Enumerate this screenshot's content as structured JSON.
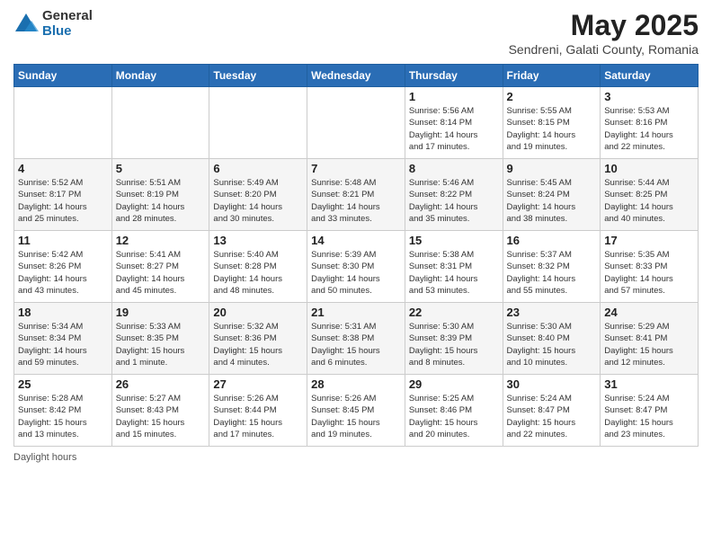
{
  "logo": {
    "general": "General",
    "blue": "Blue"
  },
  "title": "May 2025",
  "subtitle": "Sendreni, Galati County, Romania",
  "days_header": [
    "Sunday",
    "Monday",
    "Tuesday",
    "Wednesday",
    "Thursday",
    "Friday",
    "Saturday"
  ],
  "weeks": [
    [
      {
        "num": "",
        "info": ""
      },
      {
        "num": "",
        "info": ""
      },
      {
        "num": "",
        "info": ""
      },
      {
        "num": "",
        "info": ""
      },
      {
        "num": "1",
        "info": "Sunrise: 5:56 AM\nSunset: 8:14 PM\nDaylight: 14 hours\nand 17 minutes."
      },
      {
        "num": "2",
        "info": "Sunrise: 5:55 AM\nSunset: 8:15 PM\nDaylight: 14 hours\nand 19 minutes."
      },
      {
        "num": "3",
        "info": "Sunrise: 5:53 AM\nSunset: 8:16 PM\nDaylight: 14 hours\nand 22 minutes."
      }
    ],
    [
      {
        "num": "4",
        "info": "Sunrise: 5:52 AM\nSunset: 8:17 PM\nDaylight: 14 hours\nand 25 minutes."
      },
      {
        "num": "5",
        "info": "Sunrise: 5:51 AM\nSunset: 8:19 PM\nDaylight: 14 hours\nand 28 minutes."
      },
      {
        "num": "6",
        "info": "Sunrise: 5:49 AM\nSunset: 8:20 PM\nDaylight: 14 hours\nand 30 minutes."
      },
      {
        "num": "7",
        "info": "Sunrise: 5:48 AM\nSunset: 8:21 PM\nDaylight: 14 hours\nand 33 minutes."
      },
      {
        "num": "8",
        "info": "Sunrise: 5:46 AM\nSunset: 8:22 PM\nDaylight: 14 hours\nand 35 minutes."
      },
      {
        "num": "9",
        "info": "Sunrise: 5:45 AM\nSunset: 8:24 PM\nDaylight: 14 hours\nand 38 minutes."
      },
      {
        "num": "10",
        "info": "Sunrise: 5:44 AM\nSunset: 8:25 PM\nDaylight: 14 hours\nand 40 minutes."
      }
    ],
    [
      {
        "num": "11",
        "info": "Sunrise: 5:42 AM\nSunset: 8:26 PM\nDaylight: 14 hours\nand 43 minutes."
      },
      {
        "num": "12",
        "info": "Sunrise: 5:41 AM\nSunset: 8:27 PM\nDaylight: 14 hours\nand 45 minutes."
      },
      {
        "num": "13",
        "info": "Sunrise: 5:40 AM\nSunset: 8:28 PM\nDaylight: 14 hours\nand 48 minutes."
      },
      {
        "num": "14",
        "info": "Sunrise: 5:39 AM\nSunset: 8:30 PM\nDaylight: 14 hours\nand 50 minutes."
      },
      {
        "num": "15",
        "info": "Sunrise: 5:38 AM\nSunset: 8:31 PM\nDaylight: 14 hours\nand 53 minutes."
      },
      {
        "num": "16",
        "info": "Sunrise: 5:37 AM\nSunset: 8:32 PM\nDaylight: 14 hours\nand 55 minutes."
      },
      {
        "num": "17",
        "info": "Sunrise: 5:35 AM\nSunset: 8:33 PM\nDaylight: 14 hours\nand 57 minutes."
      }
    ],
    [
      {
        "num": "18",
        "info": "Sunrise: 5:34 AM\nSunset: 8:34 PM\nDaylight: 14 hours\nand 59 minutes."
      },
      {
        "num": "19",
        "info": "Sunrise: 5:33 AM\nSunset: 8:35 PM\nDaylight: 15 hours\nand 1 minute."
      },
      {
        "num": "20",
        "info": "Sunrise: 5:32 AM\nSunset: 8:36 PM\nDaylight: 15 hours\nand 4 minutes."
      },
      {
        "num": "21",
        "info": "Sunrise: 5:31 AM\nSunset: 8:38 PM\nDaylight: 15 hours\nand 6 minutes."
      },
      {
        "num": "22",
        "info": "Sunrise: 5:30 AM\nSunset: 8:39 PM\nDaylight: 15 hours\nand 8 minutes."
      },
      {
        "num": "23",
        "info": "Sunrise: 5:30 AM\nSunset: 8:40 PM\nDaylight: 15 hours\nand 10 minutes."
      },
      {
        "num": "24",
        "info": "Sunrise: 5:29 AM\nSunset: 8:41 PM\nDaylight: 15 hours\nand 12 minutes."
      }
    ],
    [
      {
        "num": "25",
        "info": "Sunrise: 5:28 AM\nSunset: 8:42 PM\nDaylight: 15 hours\nand 13 minutes."
      },
      {
        "num": "26",
        "info": "Sunrise: 5:27 AM\nSunset: 8:43 PM\nDaylight: 15 hours\nand 15 minutes."
      },
      {
        "num": "27",
        "info": "Sunrise: 5:26 AM\nSunset: 8:44 PM\nDaylight: 15 hours\nand 17 minutes."
      },
      {
        "num": "28",
        "info": "Sunrise: 5:26 AM\nSunset: 8:45 PM\nDaylight: 15 hours\nand 19 minutes."
      },
      {
        "num": "29",
        "info": "Sunrise: 5:25 AM\nSunset: 8:46 PM\nDaylight: 15 hours\nand 20 minutes."
      },
      {
        "num": "30",
        "info": "Sunrise: 5:24 AM\nSunset: 8:47 PM\nDaylight: 15 hours\nand 22 minutes."
      },
      {
        "num": "31",
        "info": "Sunrise: 5:24 AM\nSunset: 8:47 PM\nDaylight: 15 hours\nand 23 minutes."
      }
    ]
  ],
  "footer": "Daylight hours"
}
